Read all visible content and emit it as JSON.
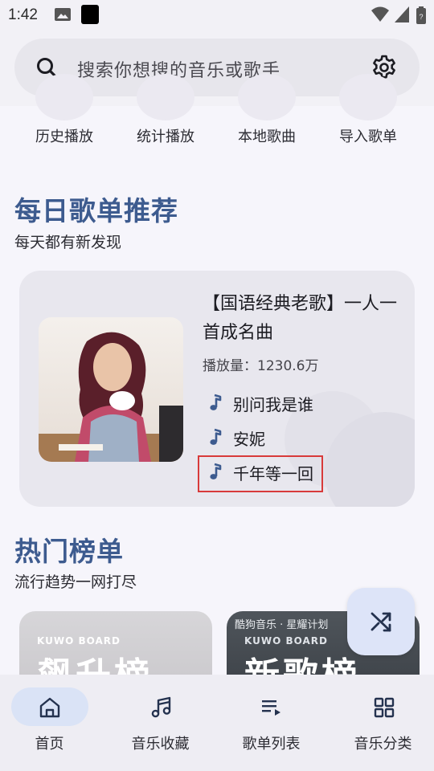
{
  "status_bar": {
    "time": "1:42"
  },
  "search": {
    "placeholder": "搜索你想搜的音乐或歌手"
  },
  "quick_actions": [
    "历史播放",
    "统计播放",
    "本地歌曲",
    "导入歌单"
  ],
  "daily_section": {
    "title": "每日歌单推荐",
    "subtitle": "每天都有新发现"
  },
  "daily_card": {
    "title": "【国语经典老歌】一人一首成名曲",
    "play_count": "播放量：1230.6万",
    "songs": [
      "别问我是谁",
      "安妮",
      "千年等一回"
    ]
  },
  "hot_section": {
    "title": "热门榜单",
    "subtitle": "流行趋势一网打尽"
  },
  "chart_cards": [
    {
      "board_tag": "KUWO BOARD",
      "big_text": "飙升榜"
    },
    {
      "caption": "酷狗音乐 · 星耀计划",
      "board_tag": "KUWO BOARD",
      "big_text": "新歌榜"
    }
  ],
  "bottom_nav": [
    "首页",
    "音乐收藏",
    "歌单列表",
    "音乐分类"
  ],
  "colors": {
    "accent": "#3d5b8f",
    "nav_active_bg": "#dae3f6",
    "highlight_box": "#d83a3a"
  }
}
